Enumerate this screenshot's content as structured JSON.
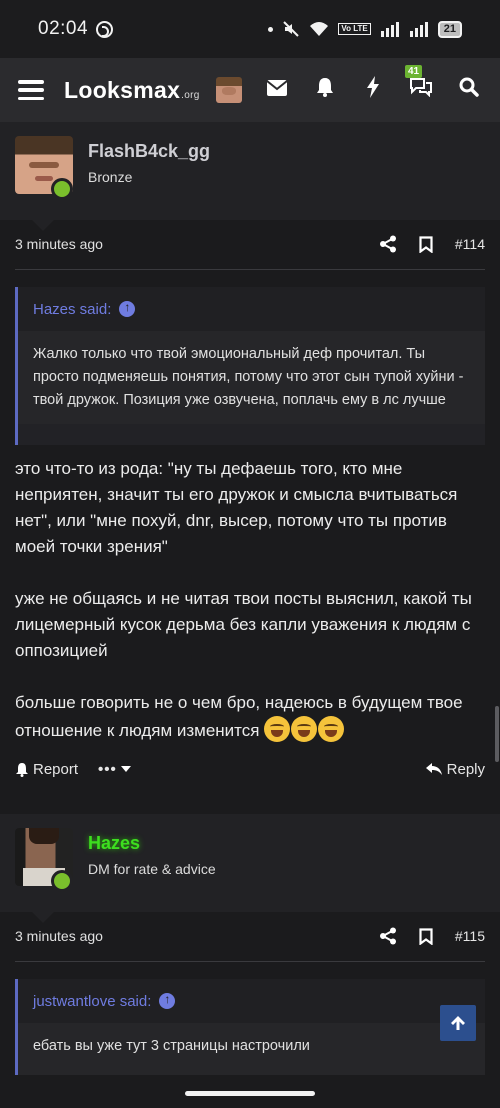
{
  "status_bar": {
    "time": "02:04",
    "battery": "21",
    "volte": "Vo LTE"
  },
  "nav": {
    "logo": "Looksmax",
    "logo_suffix": ".org",
    "notification_count": "41"
  },
  "posts": [
    {
      "username": "FlashB4ck_gg",
      "username_color": "#cfcfd4",
      "user_title": "Bronze",
      "time": "3 minutes ago",
      "post_number": "#114",
      "quote": {
        "author": "Hazes said:",
        "text": "Жалко только что твой эмоциональный деф прочитал. Ты просто подменяешь понятия, потому что этот сын тупой хуйни - твой дружок. Позиция уже озвучена, поплачь ему в лс лучше"
      },
      "paragraphs": [
        "это что-то из рода: \"ну ты дефаешь того, кто мне неприятен, значит ты его дружок и смысла вчитываться нет\", или \"мне похуй, dnr, высер, потому что ты против моей точки зрения\"",
        "уже не общаясь и не читая твои посты выяснил, какой ты лицемерный кусок дерьма без капли уважения к людям с оппозицией",
        "больше говорить не о чем бро, надеюсь в будущем твое отношение к людям изменится"
      ],
      "actions": {
        "report": "Report",
        "more": "•••",
        "reply": "Reply"
      }
    },
    {
      "username": "Hazes",
      "username_color": "#3dde1f",
      "user_title": "DM for rate & advice",
      "time": "3 minutes ago",
      "post_number": "#115",
      "quote": {
        "author": "justwantlove said:",
        "text": "ебать вы уже тут 3 страницы настрочили"
      }
    }
  ]
}
